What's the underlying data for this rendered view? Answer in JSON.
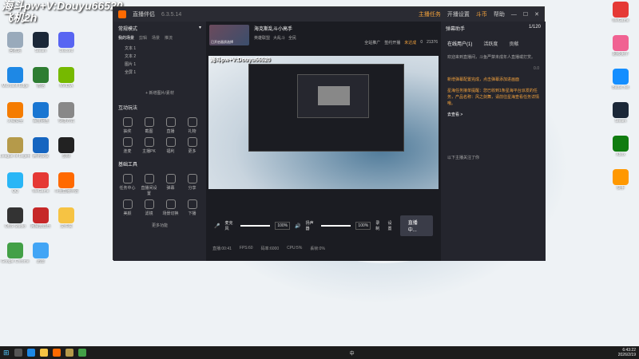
{
  "watermark": {
    "line1": "海斗pw+V:Douyu66520",
    "line2": "飞机2h"
  },
  "desktop_icons_left": [
    {
      "label": "回收站",
      "color": "#9ab"
    },
    {
      "label": "Microsoft Edge",
      "color": "#1e88e5"
    },
    {
      "label": "火绒安全",
      "color": "#f57c00"
    },
    {
      "label": "League of Legends",
      "color": "#b59a4a"
    },
    {
      "label": "QQ",
      "color": "#29b6f6"
    },
    {
      "label": "OBS Studio",
      "color": "#333"
    },
    {
      "label": "Google Chrome",
      "color": "#43a047"
    },
    {
      "label": "Steam",
      "color": "#1b2838"
    },
    {
      "label": "微信",
      "color": "#2e7d32"
    },
    {
      "label": "百度网盘",
      "color": "#1976d2"
    },
    {
      "label": "腾讯会议",
      "color": "#1565c0"
    },
    {
      "label": "WeGame",
      "color": "#e53935"
    },
    {
      "label": "网易云音乐",
      "color": "#c62828"
    },
    {
      "label": "迅雷",
      "color": "#42a5f5"
    },
    {
      "label": "Discord",
      "color": "#5865f2"
    },
    {
      "label": "NVIDIA",
      "color": "#76b900"
    },
    {
      "label": "快捷方式",
      "color": "#888"
    },
    {
      "label": "剪映",
      "color": "#222"
    },
    {
      "label": "斗鱼直播伴侣",
      "color": "#ff6a00"
    },
    {
      "label": "文件夹",
      "color": "#f6c343"
    }
  ],
  "desktop_icons_right": [
    {
      "label": "WeGame",
      "color": "#e53935"
    },
    {
      "label": "超级兔子",
      "color": "#f06292"
    },
    {
      "label": "Battle.net",
      "color": "#148eff"
    },
    {
      "label": "Steam",
      "color": "#1b2838"
    },
    {
      "label": "Xbox",
      "color": "#107c10"
    },
    {
      "label": "快手",
      "color": "#ff9800"
    }
  ],
  "app": {
    "title": "直播伴侣",
    "version": "6.3.5.14",
    "titlebar_items": [
      "主播任务",
      "开播设置",
      "斗币",
      "帮助"
    ],
    "stream_title": "海克斯乱斗小高手",
    "stream_subtitle": "已开启画质选择",
    "categories": [
      "英雄联盟",
      "大乱斗",
      "全民"
    ],
    "stats": [
      "全站推广",
      "签约开播",
      "未达成",
      "0",
      "21376"
    ],
    "viewers": "1/120",
    "scenes_header": "常规模式",
    "scenes_tabs": [
      "我的场景",
      "剪辑",
      "场景",
      "推流"
    ],
    "scenes": [
      "文本 1",
      "文本 2",
      "图片 1",
      "全屏 1"
    ],
    "add_source": "+ 新增图片/素材",
    "interaction_title": "互动玩法",
    "interaction_items": [
      "抽奖",
      "截图",
      "直播",
      "礼物",
      "连麦",
      "主播PK",
      "福利",
      "更多"
    ],
    "tools_title": "基础工具",
    "tools_items": [
      "任务中心",
      "直播间设置",
      "弹幕",
      "分享",
      "美颜",
      "滤镜",
      "场景切换",
      "下播"
    ],
    "more": "更多功能",
    "mic_label": "麦克风",
    "mic_pct": "100%",
    "speaker_label": "扬声器",
    "speaker_pct": "100%",
    "record_label": "录制",
    "settings_label": "设置",
    "live_button": "直播中...",
    "status": [
      "直播:00:41",
      "FPS:60",
      "码率:6000",
      "CPU:5%",
      "丢帧:0%"
    ],
    "right_tabs": [
      "在线用户(1)",
      "活跃度",
      "贡献"
    ],
    "right_header": "弹幕助手",
    "notice1": "欢迎来到直播间，斗鱼严禁未成年人直播或打赏。",
    "notice2": "新增弹幕配置完成，点击弹幕添加进画面",
    "notice3": "星海任务接单提醒：您已收到1条星海平台派发的任务，产品名称：风之剑舞，请前往星海查看任务详情哦。",
    "view_more": "去查看 >",
    "bottom_hint": "以下主播关注了你",
    "gift_count": "0.0"
  },
  "taskbar": {
    "time": "6:43:22",
    "date": "2026/2/19",
    "lang": "中"
  }
}
